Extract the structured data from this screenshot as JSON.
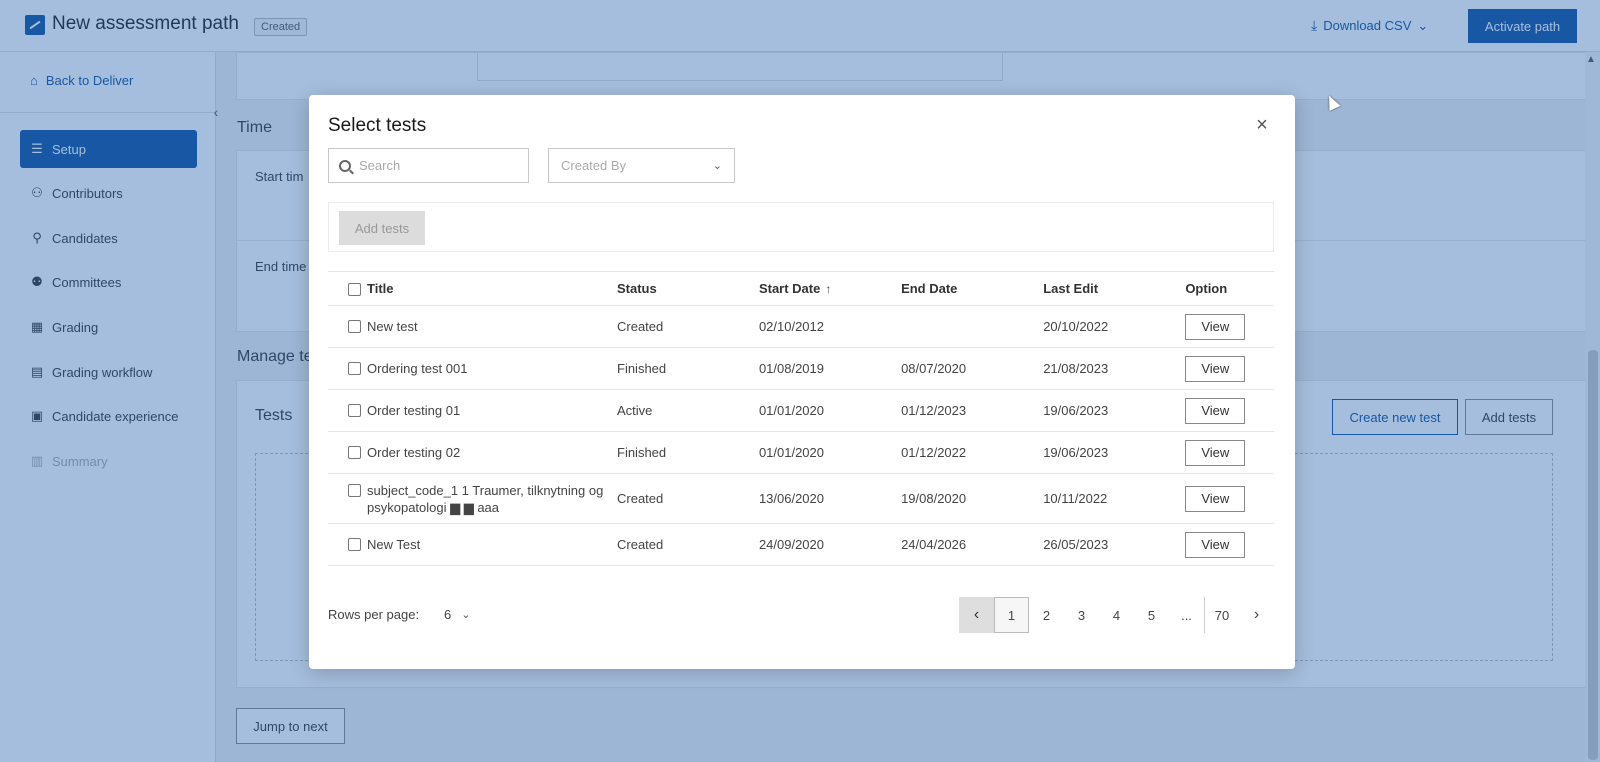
{
  "header": {
    "title": "New assessment path",
    "status_badge": "Created",
    "download_csv": "Download CSV",
    "activate_button": "Activate path"
  },
  "sidebar": {
    "back_link": "Back to Deliver",
    "items": [
      {
        "label": "Setup",
        "icon": "setup-icon",
        "active": true
      },
      {
        "label": "Contributors",
        "icon": "contributors-icon"
      },
      {
        "label": "Candidates",
        "icon": "user-icon"
      },
      {
        "label": "Committees",
        "icon": "users-icon"
      },
      {
        "label": "Grading",
        "icon": "grading-icon"
      },
      {
        "label": "Grading workflow",
        "icon": "workflow-icon"
      },
      {
        "label": "Candidate experience",
        "icon": "experience-icon"
      },
      {
        "label": "Summary",
        "icon": "summary-icon",
        "disabled": true
      }
    ]
  },
  "background": {
    "time_section": "Time",
    "start_time_label": "Start tim",
    "end_time_label": "End time",
    "manage_section": "Manage te",
    "tests_title": "Tests",
    "create_new_test": "Create new test",
    "add_tests": "Add tests",
    "jump_to_next": "Jump to next"
  },
  "modal": {
    "title": "Select tests",
    "search_placeholder": "Search",
    "created_by_placeholder": "Created By",
    "add_tests_button": "Add tests",
    "columns": [
      "Title",
      "Status",
      "Start Date",
      "End Date",
      "Last Edit",
      "Option"
    ],
    "rows": [
      {
        "title": "New test",
        "status": "Created",
        "start": "02/10/2012",
        "end": "",
        "edit": "20/10/2022",
        "option": "View"
      },
      {
        "title": "Ordering test 001",
        "status": "Finished",
        "start": "01/08/2019",
        "end": "08/07/2020",
        "edit": "21/08/2023",
        "option": "View"
      },
      {
        "title": "Order testing 01",
        "status": "Active",
        "start": "01/01/2020",
        "end": "01/12/2023",
        "edit": "19/06/2023",
        "option": "View"
      },
      {
        "title": "Order testing 02",
        "status": "Finished",
        "start": "01/01/2020",
        "end": "01/12/2022",
        "edit": "19/06/2023",
        "option": "View"
      },
      {
        "title": "subject_code_1 1 Traumer, tilknytning og psykopatologi ▆ ▆ aaa",
        "status": "Created",
        "start": "13/06/2020",
        "end": "19/08/2020",
        "edit": "10/11/2022",
        "option": "View"
      },
      {
        "title": "New Test",
        "status": "Created",
        "start": "24/09/2020",
        "end": "24/04/2026",
        "edit": "26/05/2023",
        "option": "View"
      }
    ],
    "rows_per_page_label": "Rows per page:",
    "rows_per_page_value": "6",
    "pagination": {
      "pages": [
        "1",
        "2",
        "3",
        "4",
        "5",
        "...",
        "70"
      ],
      "current": "1"
    }
  },
  "colors": {
    "brand": "#0b4f9c",
    "overlay": "#2864af"
  }
}
